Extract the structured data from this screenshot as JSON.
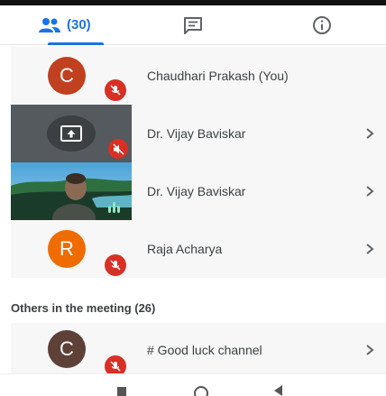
{
  "tabs": {
    "people": {
      "count_label": "(30)",
      "icon": "people-icon",
      "active": true
    },
    "chat": {
      "icon": "chat-icon"
    },
    "info": {
      "icon": "info-icon"
    }
  },
  "participants": [
    {
      "name": "Chaudhari Prakash (You)",
      "initial": "C",
      "avatar_color": "#c1401f",
      "muted": true,
      "has_chevron": false
    },
    {
      "name": "Dr. Vijay Baviskar",
      "video": "presenting-screen",
      "muted": true,
      "has_chevron": true
    },
    {
      "name": "Dr. Vijay Baviskar",
      "video": "camera-feed",
      "speaking": true,
      "has_chevron": true
    },
    {
      "name": "Raja Acharya",
      "initial": "R",
      "avatar_color": "#ef6c00",
      "muted": true,
      "has_chevron": true
    }
  ],
  "others": {
    "title": "Others in the meeting (26)",
    "items": [
      {
        "name": "# Good luck channel",
        "initial": "C",
        "avatar_color": "#5d4037",
        "muted": true,
        "has_chevron": true
      }
    ]
  },
  "colors": {
    "accent": "#1a73e8",
    "mute": "#d93025",
    "row_bg": "#f7f7f7"
  }
}
